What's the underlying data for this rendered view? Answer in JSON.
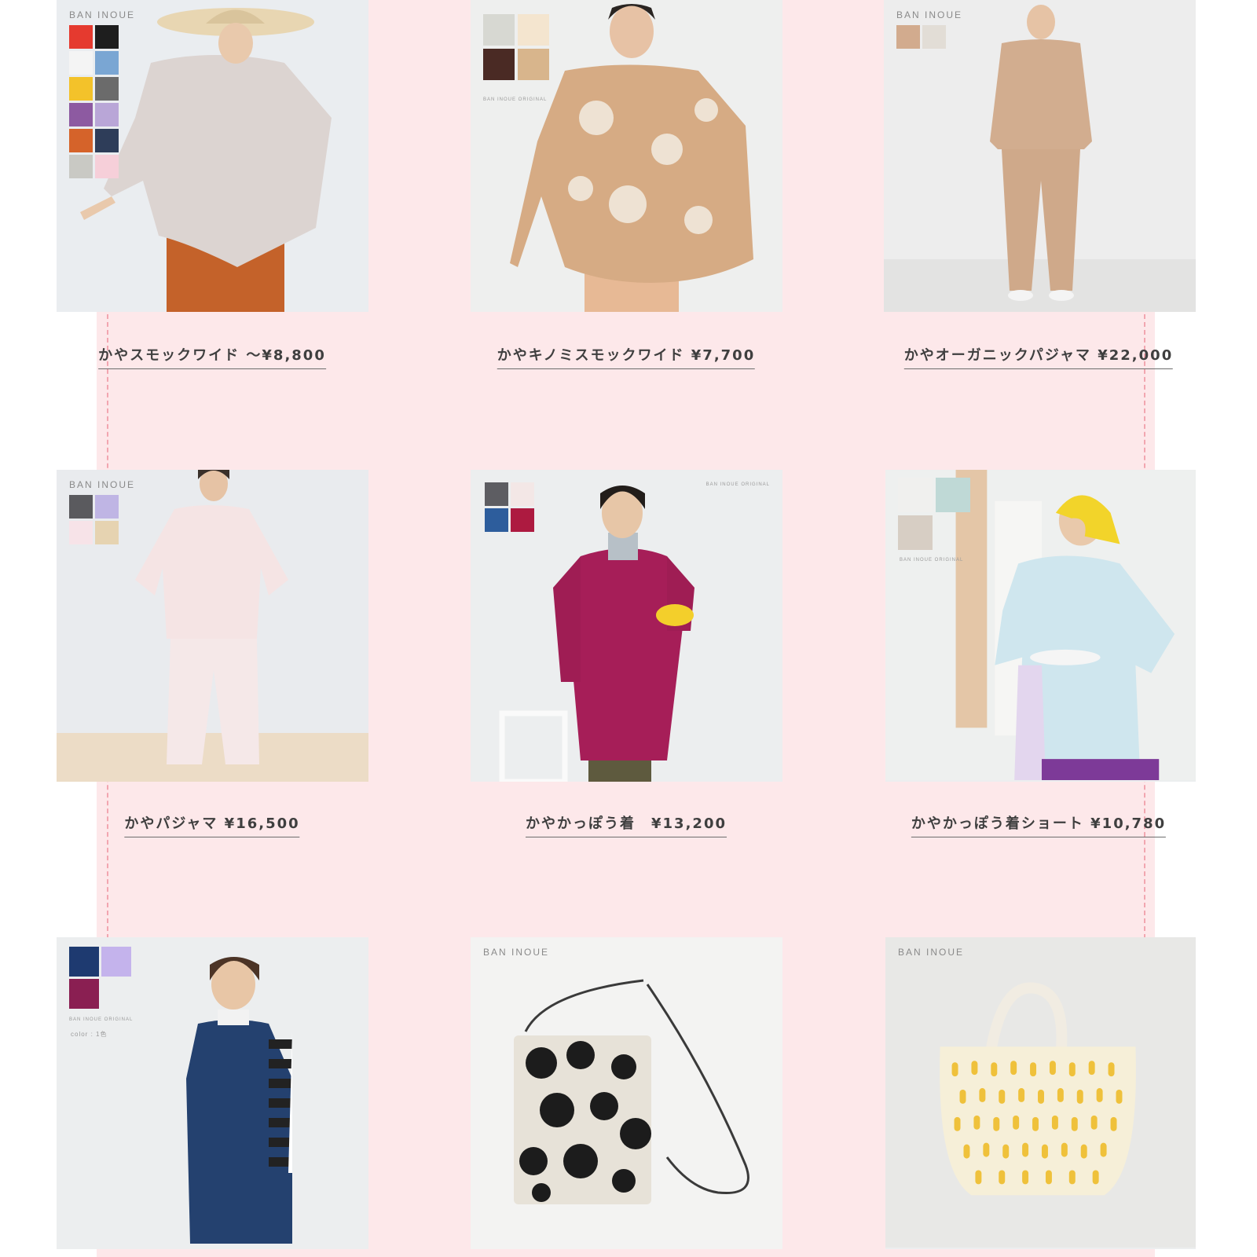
{
  "brand": "BAN INOUE",
  "tiny_text": "BAN INOUE ORIGINAL",
  "color_note": "color : 1色",
  "colors": {
    "page_background": "#ffffff",
    "pink_band": "#fde8ea",
    "dashed_guide": "#f2a6b0",
    "caption_text": "#3f3f3f"
  },
  "products": [
    {
      "caption": "かやスモックワイド ～¥8,800",
      "image": "linen-wide-smock-greige",
      "swatches": [
        "#e53a2f",
        "#1e1e1e",
        "#f4f4f4",
        "#7aa6d3",
        "#f3c22a",
        "#6b6b6b",
        "#8d5aa1",
        "#b9a6d7",
        "#d5632a",
        "#2e3d59",
        "#c9c9c4",
        "#f6cfd9"
      ]
    },
    {
      "caption": "かやキノミスモックワイド ¥7,700",
      "image": "kinomi-print-smock-beige",
      "swatches": [
        "#d7d8d2",
        "#f4e5cf",
        "#4a2a24",
        "#d8b58c"
      ]
    },
    {
      "caption": "かやオーガニックパジャマ ¥22,000",
      "image": "organic-pajama-beige",
      "swatches": [
        "#d2ab8e",
        "#e2ddd6"
      ]
    },
    {
      "caption": "かやパジャマ ¥16,500",
      "image": "pajama-pale-pink",
      "swatches": [
        "#5a5a5e",
        "#bfb5e4",
        "#f7e3e8",
        "#e6d3b1"
      ]
    },
    {
      "caption": "かやかっぽう着　¥13,200",
      "image": "kappogi-magenta",
      "swatches": [
        "#5d5d62",
        "#f3e7e6",
        "#2d5d9c",
        "#ad1a40"
      ]
    },
    {
      "caption": "かやかっぽう着ショート ¥10,780",
      "image": "kappogi-short-light-blue",
      "swatches": [
        "#f0f0ee",
        "#bfd9d6",
        "#d7cec4"
      ]
    },
    {
      "caption": "",
      "image": "navy-vest-apron",
      "swatches": [
        "#1e3a70",
        "#c4b3ec",
        "#8a1f52"
      ]
    },
    {
      "caption": "",
      "image": "kinomi-shoulder-pochette",
      "swatches": []
    },
    {
      "caption": "",
      "image": "yellow-pattern-tote",
      "swatches": []
    }
  ]
}
